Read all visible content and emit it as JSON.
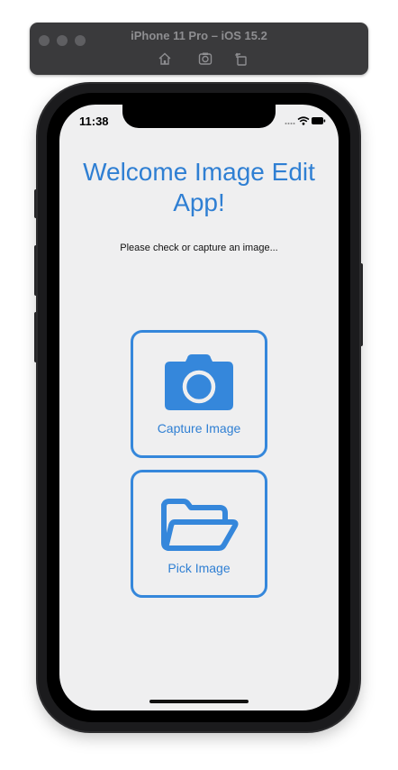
{
  "simulator": {
    "title": "iPhone 11 Pro – iOS 15.2",
    "toolbar_icons": [
      "home-icon",
      "screenshot-icon",
      "rotate-icon"
    ]
  },
  "status_bar": {
    "time": "11:38",
    "icons": [
      "signal-dots-icon",
      "wifi-icon",
      "battery-icon"
    ]
  },
  "app": {
    "welcome_title": "Welcome Image Edit App!",
    "subtitle": "Please check or capture an image...",
    "buttons": [
      {
        "label": "Capture Image",
        "icon": "camera-icon"
      },
      {
        "label": "Pick Image",
        "icon": "folder-icon"
      }
    ]
  },
  "colors": {
    "accent": "#2f7fd3",
    "screen_background": "#efeff0",
    "simulator_bar": "#3a3a3c"
  }
}
